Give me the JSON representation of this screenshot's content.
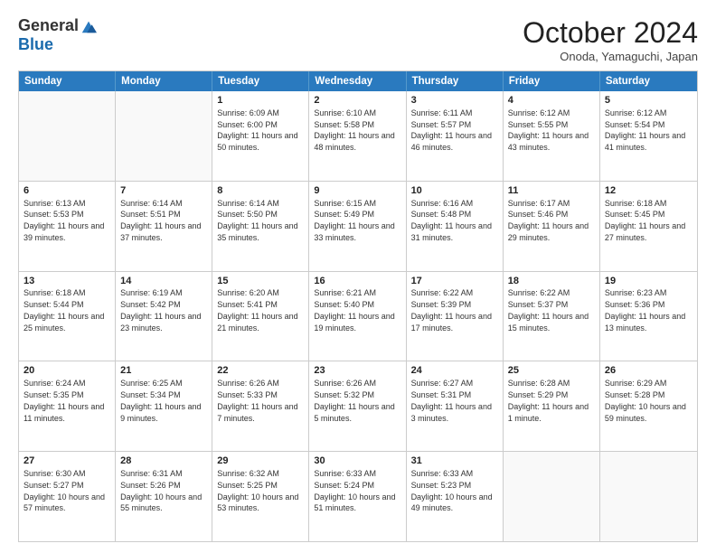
{
  "logo": {
    "general": "General",
    "blue": "Blue"
  },
  "title": "October 2024",
  "subtitle": "Onoda, Yamaguchi, Japan",
  "days": [
    "Sunday",
    "Monday",
    "Tuesday",
    "Wednesday",
    "Thursday",
    "Friday",
    "Saturday"
  ],
  "rows": [
    [
      {
        "day": "",
        "empty": true
      },
      {
        "day": "",
        "empty": true
      },
      {
        "day": "1",
        "sunrise": "Sunrise: 6:09 AM",
        "sunset": "Sunset: 6:00 PM",
        "daylight": "Daylight: 11 hours and 50 minutes."
      },
      {
        "day": "2",
        "sunrise": "Sunrise: 6:10 AM",
        "sunset": "Sunset: 5:58 PM",
        "daylight": "Daylight: 11 hours and 48 minutes."
      },
      {
        "day": "3",
        "sunrise": "Sunrise: 6:11 AM",
        "sunset": "Sunset: 5:57 PM",
        "daylight": "Daylight: 11 hours and 46 minutes."
      },
      {
        "day": "4",
        "sunrise": "Sunrise: 6:12 AM",
        "sunset": "Sunset: 5:55 PM",
        "daylight": "Daylight: 11 hours and 43 minutes."
      },
      {
        "day": "5",
        "sunrise": "Sunrise: 6:12 AM",
        "sunset": "Sunset: 5:54 PM",
        "daylight": "Daylight: 11 hours and 41 minutes."
      }
    ],
    [
      {
        "day": "6",
        "sunrise": "Sunrise: 6:13 AM",
        "sunset": "Sunset: 5:53 PM",
        "daylight": "Daylight: 11 hours and 39 minutes."
      },
      {
        "day": "7",
        "sunrise": "Sunrise: 6:14 AM",
        "sunset": "Sunset: 5:51 PM",
        "daylight": "Daylight: 11 hours and 37 minutes."
      },
      {
        "day": "8",
        "sunrise": "Sunrise: 6:14 AM",
        "sunset": "Sunset: 5:50 PM",
        "daylight": "Daylight: 11 hours and 35 minutes."
      },
      {
        "day": "9",
        "sunrise": "Sunrise: 6:15 AM",
        "sunset": "Sunset: 5:49 PM",
        "daylight": "Daylight: 11 hours and 33 minutes."
      },
      {
        "day": "10",
        "sunrise": "Sunrise: 6:16 AM",
        "sunset": "Sunset: 5:48 PM",
        "daylight": "Daylight: 11 hours and 31 minutes."
      },
      {
        "day": "11",
        "sunrise": "Sunrise: 6:17 AM",
        "sunset": "Sunset: 5:46 PM",
        "daylight": "Daylight: 11 hours and 29 minutes."
      },
      {
        "day": "12",
        "sunrise": "Sunrise: 6:18 AM",
        "sunset": "Sunset: 5:45 PM",
        "daylight": "Daylight: 11 hours and 27 minutes."
      }
    ],
    [
      {
        "day": "13",
        "sunrise": "Sunrise: 6:18 AM",
        "sunset": "Sunset: 5:44 PM",
        "daylight": "Daylight: 11 hours and 25 minutes."
      },
      {
        "day": "14",
        "sunrise": "Sunrise: 6:19 AM",
        "sunset": "Sunset: 5:42 PM",
        "daylight": "Daylight: 11 hours and 23 minutes."
      },
      {
        "day": "15",
        "sunrise": "Sunrise: 6:20 AM",
        "sunset": "Sunset: 5:41 PM",
        "daylight": "Daylight: 11 hours and 21 minutes."
      },
      {
        "day": "16",
        "sunrise": "Sunrise: 6:21 AM",
        "sunset": "Sunset: 5:40 PM",
        "daylight": "Daylight: 11 hours and 19 minutes."
      },
      {
        "day": "17",
        "sunrise": "Sunrise: 6:22 AM",
        "sunset": "Sunset: 5:39 PM",
        "daylight": "Daylight: 11 hours and 17 minutes."
      },
      {
        "day": "18",
        "sunrise": "Sunrise: 6:22 AM",
        "sunset": "Sunset: 5:37 PM",
        "daylight": "Daylight: 11 hours and 15 minutes."
      },
      {
        "day": "19",
        "sunrise": "Sunrise: 6:23 AM",
        "sunset": "Sunset: 5:36 PM",
        "daylight": "Daylight: 11 hours and 13 minutes."
      }
    ],
    [
      {
        "day": "20",
        "sunrise": "Sunrise: 6:24 AM",
        "sunset": "Sunset: 5:35 PM",
        "daylight": "Daylight: 11 hours and 11 minutes."
      },
      {
        "day": "21",
        "sunrise": "Sunrise: 6:25 AM",
        "sunset": "Sunset: 5:34 PM",
        "daylight": "Daylight: 11 hours and 9 minutes."
      },
      {
        "day": "22",
        "sunrise": "Sunrise: 6:26 AM",
        "sunset": "Sunset: 5:33 PM",
        "daylight": "Daylight: 11 hours and 7 minutes."
      },
      {
        "day": "23",
        "sunrise": "Sunrise: 6:26 AM",
        "sunset": "Sunset: 5:32 PM",
        "daylight": "Daylight: 11 hours and 5 minutes."
      },
      {
        "day": "24",
        "sunrise": "Sunrise: 6:27 AM",
        "sunset": "Sunset: 5:31 PM",
        "daylight": "Daylight: 11 hours and 3 minutes."
      },
      {
        "day": "25",
        "sunrise": "Sunrise: 6:28 AM",
        "sunset": "Sunset: 5:29 PM",
        "daylight": "Daylight: 11 hours and 1 minute."
      },
      {
        "day": "26",
        "sunrise": "Sunrise: 6:29 AM",
        "sunset": "Sunset: 5:28 PM",
        "daylight": "Daylight: 10 hours and 59 minutes."
      }
    ],
    [
      {
        "day": "27",
        "sunrise": "Sunrise: 6:30 AM",
        "sunset": "Sunset: 5:27 PM",
        "daylight": "Daylight: 10 hours and 57 minutes."
      },
      {
        "day": "28",
        "sunrise": "Sunrise: 6:31 AM",
        "sunset": "Sunset: 5:26 PM",
        "daylight": "Daylight: 10 hours and 55 minutes."
      },
      {
        "day": "29",
        "sunrise": "Sunrise: 6:32 AM",
        "sunset": "Sunset: 5:25 PM",
        "daylight": "Daylight: 10 hours and 53 minutes."
      },
      {
        "day": "30",
        "sunrise": "Sunrise: 6:33 AM",
        "sunset": "Sunset: 5:24 PM",
        "daylight": "Daylight: 10 hours and 51 minutes."
      },
      {
        "day": "31",
        "sunrise": "Sunrise: 6:33 AM",
        "sunset": "Sunset: 5:23 PM",
        "daylight": "Daylight: 10 hours and 49 minutes."
      },
      {
        "day": "",
        "empty": true
      },
      {
        "day": "",
        "empty": true
      }
    ]
  ]
}
